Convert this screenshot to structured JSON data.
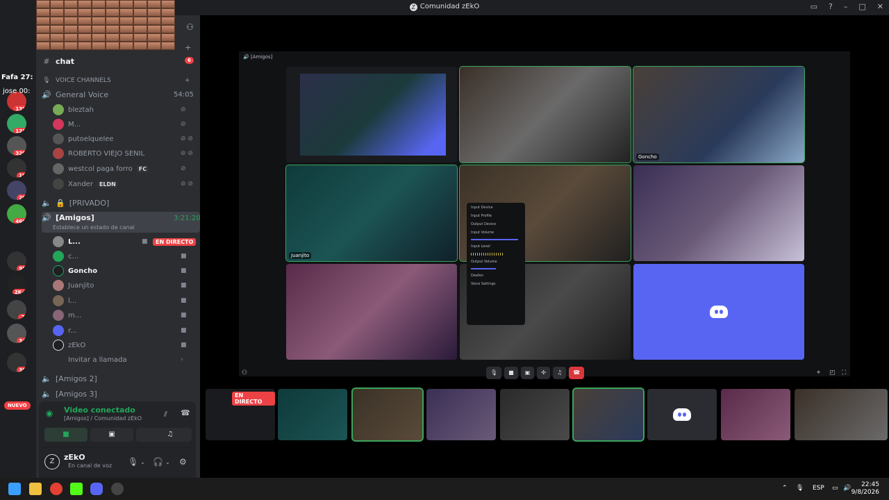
{
  "window": {
    "title": "Comunidad zEkO"
  },
  "servers": {
    "badges": [
      "135",
      "128",
      "329",
      "19",
      "29",
      "460",
      "95",
      "2K+",
      "7",
      "34",
      "30"
    ],
    "nuevo": "NUEVO"
  },
  "sidebar_top": {
    "chat_label": "chat",
    "chat_badge": "6",
    "overlay_text_1": "Fafa 27:",
    "overlay_text_2": "jose 00:"
  },
  "channels": {
    "voice_category": "VOICE CHANNELS",
    "general_voice": {
      "name": "General Voice",
      "time": "54:05"
    },
    "general_users": [
      {
        "name": "bleztah"
      },
      {
        "name": "M..."
      },
      {
        "name": "putoelquelee"
      },
      {
        "name": "ROBERTO VIEJO SENIL"
      },
      {
        "name": "westcol paga forro",
        "tag": "FC"
      },
      {
        "name": "Xander",
        "tag": "ELDN"
      }
    ],
    "privado": "[PRIVADO]",
    "amigos": {
      "name": "[Amigos]",
      "time": "3:21:20",
      "status": "Establece un estado de canal"
    },
    "amigos_users": [
      {
        "name": "L...",
        "live": "EN DIRECTO"
      },
      {
        "name": "c..."
      },
      {
        "name": "Goncho"
      },
      {
        "name": "Juanjito"
      },
      {
        "name": "l..."
      },
      {
        "name": "m..."
      },
      {
        "name": "r..."
      },
      {
        "name": "zEkO"
      }
    ],
    "invite": "Invitar a llamada",
    "amigos2": "[Amigos 2]",
    "amigos3": "[Amigos 3]"
  },
  "voice_panel": {
    "title": "Video conectado",
    "subtitle": "[Amigos] / Comunidad zEkO",
    "user_name": "zEkO",
    "user_status": "En canal de voz"
  },
  "stage": {
    "inner_header": "[Amigos]",
    "tile_names": [
      "Goncho",
      "Juanjito"
    ],
    "popup": {
      "input_device": "Input Device",
      "input_profile": "Input Profile",
      "output_device": "Output Device",
      "input_volume": "Input Volume",
      "input_level": "Input Level",
      "output_volume": "Output Volume",
      "deafen": "Deafen",
      "voice_settings": "Voice Settings"
    },
    "strip_live": "EN DIRECTO"
  },
  "taskbar": {
    "lang": "ESP",
    "time": "22:45",
    "date": "9/8/2026"
  }
}
